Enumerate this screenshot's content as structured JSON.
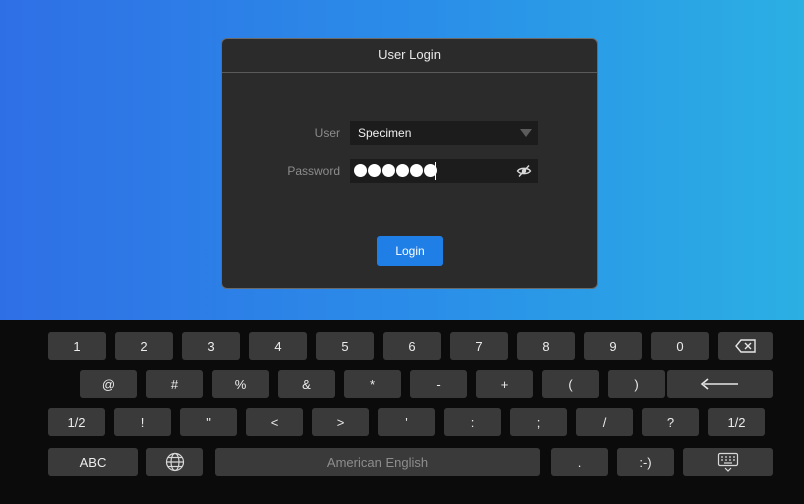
{
  "dialog": {
    "title": "User Login",
    "user_label": "User",
    "user_value": "Specimen",
    "password_label": "Password",
    "password_masked_length": 6,
    "login_label": "Login"
  },
  "keyboard": {
    "row1": [
      "1",
      "2",
      "3",
      "4",
      "5",
      "6",
      "7",
      "8",
      "9",
      "0"
    ],
    "row2": [
      "@",
      "#",
      "%",
      "&",
      "*",
      "-",
      "+",
      "(",
      ")"
    ],
    "row3": [
      "1/2",
      "!",
      "\"",
      "<",
      ">",
      "'",
      ":",
      ";",
      "/",
      "?",
      "1/2"
    ],
    "row4": {
      "abc": "ABC",
      "space": "American English",
      "dot": ".",
      "smiley": ":-)"
    }
  },
  "icons": {
    "dropdown": "chevron-down-icon",
    "password_toggle": "eye-off-icon",
    "backspace": "backspace-icon",
    "enter": "enter-icon",
    "language": "globe-icon",
    "hide_keyboard": "keyboard-hide-icon"
  },
  "colors": {
    "accent": "#1f7fe6",
    "key": "#3a3a3a",
    "dialog": "#2b2b2b"
  }
}
